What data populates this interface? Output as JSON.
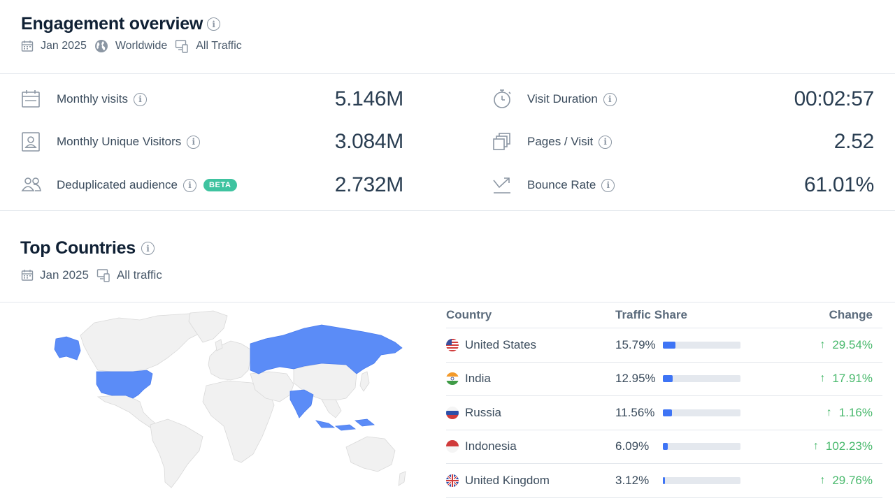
{
  "engagement": {
    "title": "Engagement overview",
    "filters": [
      {
        "icon": "calendar-icon",
        "label": "Jan 2025"
      },
      {
        "icon": "globe-icon",
        "label": "Worldwide"
      },
      {
        "icon": "devices-icon",
        "label": "All Traffic"
      }
    ],
    "metrics": {
      "monthly_visits": {
        "label": "Monthly visits",
        "value": "5.146M",
        "icon": "calendar-icon"
      },
      "unique_visitors": {
        "label": "Monthly Unique Visitors",
        "value": "3.084M",
        "icon": "user-badge-icon"
      },
      "dedup_audience": {
        "label": "Deduplicated audience",
        "value": "2.732M",
        "icon": "people-icon",
        "badge": "BETA"
      },
      "visit_duration": {
        "label": "Visit Duration",
        "value": "00:02:57",
        "icon": "stopwatch-icon"
      },
      "pages_visit": {
        "label": "Pages / Visit",
        "value": "2.52",
        "icon": "pages-icon"
      },
      "bounce_rate": {
        "label": "Bounce Rate",
        "value": "61.01%",
        "icon": "bounce-arrow-icon"
      }
    }
  },
  "top_countries": {
    "title": "Top Countries",
    "filters": [
      {
        "icon": "calendar-icon",
        "label": "Jan 2025"
      },
      {
        "icon": "devices-icon",
        "label": "All traffic"
      }
    ],
    "columns": {
      "country": "Country",
      "share": "Traffic Share",
      "change": "Change"
    },
    "rows": [
      {
        "country": "United States",
        "share": "15.79%",
        "share_pct": 15.79,
        "change": "29.54%",
        "flag": "us"
      },
      {
        "country": "India",
        "share": "12.95%",
        "share_pct": 12.95,
        "change": "17.91%",
        "flag": "in"
      },
      {
        "country": "Russia",
        "share": "11.56%",
        "share_pct": 11.56,
        "change": "1.16%",
        "flag": "ru"
      },
      {
        "country": "Indonesia",
        "share": "6.09%",
        "share_pct": 6.09,
        "change": "102.23%",
        "flag": "id"
      },
      {
        "country": "United Kingdom",
        "share": "3.12%",
        "share_pct": 3.12,
        "change": "29.76%",
        "flag": "gb"
      }
    ],
    "up_arrow": "↑",
    "colors": {
      "highlight": "#5b8cf7",
      "land": "#f1f1f1",
      "bar": "#3e74f5",
      "positive": "#47b86b"
    }
  }
}
